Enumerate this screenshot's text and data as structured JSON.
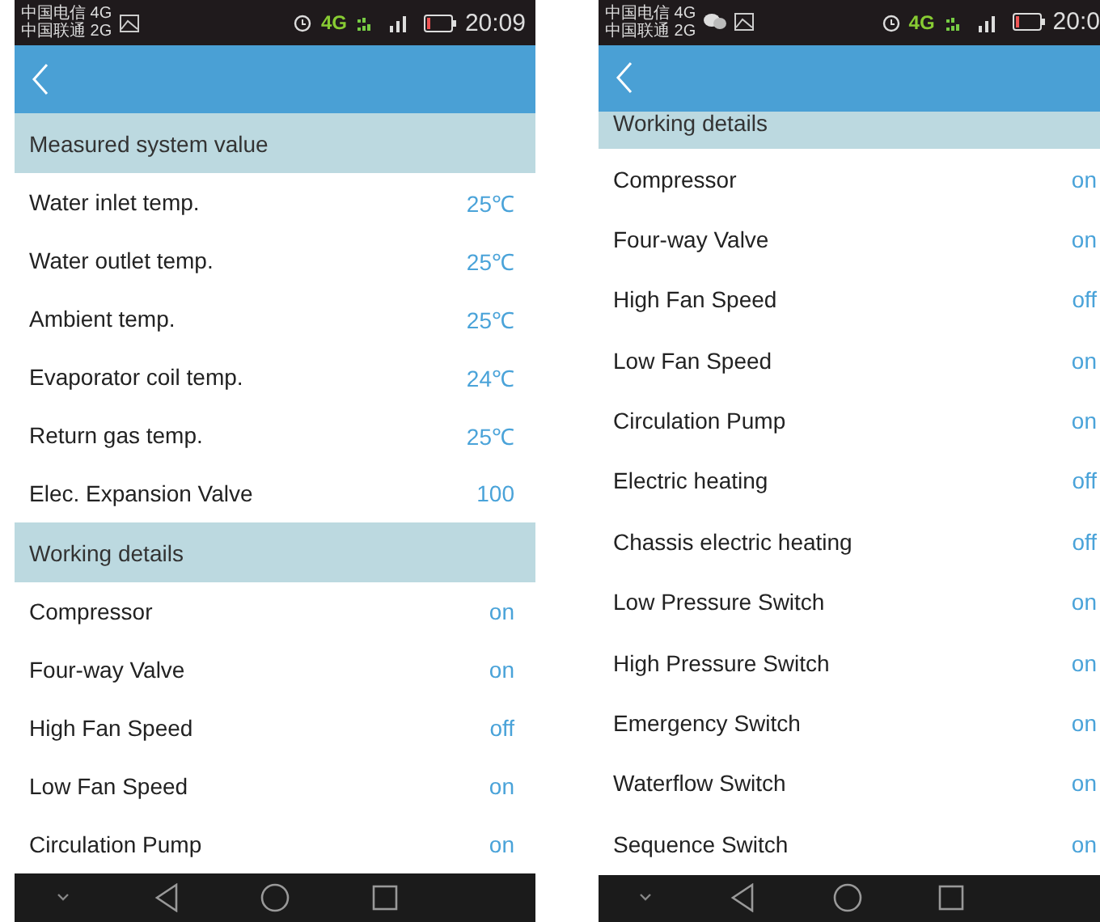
{
  "phones": [
    {
      "scrolled": false,
      "status_bar": {
        "carriers": [
          "中国电信 4G",
          "中国联通 2G"
        ],
        "notifications": [
          {
            "kind": "image"
          }
        ],
        "network": "4G",
        "time": "20:09"
      },
      "sections": [
        {
          "title": "Measured system value",
          "rows": [
            {
              "label": "Water inlet temp.",
              "value": "25℃"
            },
            {
              "label": "Water outlet temp.",
              "value": "25℃"
            },
            {
              "label": "Ambient temp.",
              "value": "25℃"
            },
            {
              "label": "Evaporator coil temp.",
              "value": "24℃"
            },
            {
              "label": "Return gas temp.",
              "value": "25℃"
            },
            {
              "label": "Elec. Expansion Valve",
              "value": "100"
            }
          ]
        },
        {
          "title": "Working details",
          "rows": [
            {
              "label": "Compressor",
              "value": "on"
            },
            {
              "label": "Four-way Valve",
              "value": "on"
            },
            {
              "label": "High Fan Speed",
              "value": "off"
            },
            {
              "label": "Low Fan Speed",
              "value": "on"
            },
            {
              "label": "Circulation Pump",
              "value": "on"
            }
          ]
        }
      ]
    },
    {
      "scrolled": true,
      "status_bar": {
        "carriers": [
          "中国电信 4G",
          "中国联通 2G"
        ],
        "notifications": [
          {
            "kind": "chat"
          },
          {
            "kind": "image"
          }
        ],
        "network": "4G",
        "time": "20:0"
      },
      "sections": [
        {
          "title": "Working details",
          "rows": [
            {
              "label": "Compressor",
              "value": "on"
            },
            {
              "label": "Four-way Valve",
              "value": "on"
            },
            {
              "label": "High Fan Speed",
              "value": "off"
            },
            {
              "label": "Low Fan Speed",
              "value": "on"
            },
            {
              "label": "Circulation Pump",
              "value": "on"
            },
            {
              "label": "Electric heating",
              "value": "off"
            },
            {
              "label": "Chassis electric heating",
              "value": "off"
            },
            {
              "label": "Low Pressure Switch",
              "value": "on"
            },
            {
              "label": "High Pressure Switch",
              "value": "on"
            },
            {
              "label": "Emergency Switch",
              "value": "on"
            },
            {
              "label": "Waterflow Switch",
              "value": "on"
            },
            {
              "label": "Sequence Switch",
              "value": "on"
            }
          ]
        }
      ]
    }
  ]
}
